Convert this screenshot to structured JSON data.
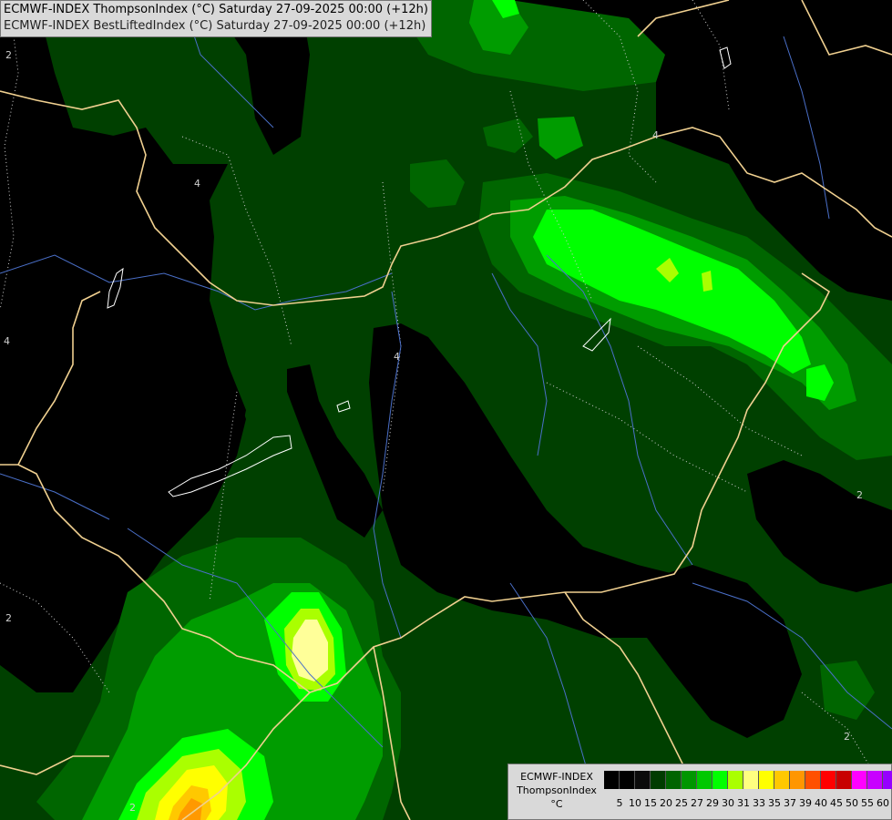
{
  "header": {
    "line1": "ECMWF-INDEX ThompsonIndex (°C) Saturday 27-09-2025 00:00 (+12h)",
    "line2": "ECMWF-INDEX BestLiftedIndex (°C) Saturday 27-09-2025 00:00 (+12h)"
  },
  "legend": {
    "title_line1": "ECMWF-INDEX",
    "title_line2": "ThompsonIndex",
    "title_line3": "°C",
    "colors": [
      "#000000",
      "#000000",
      "#0b0b0b",
      "#003c00",
      "#006400",
      "#009600",
      "#00c800",
      "#00ff00",
      "#aaff00",
      "#ffff80",
      "#ffff00",
      "#ffc800",
      "#ff9600",
      "#ff5000",
      "#ff0000",
      "#c80000",
      "#ff00ff",
      "#c800ff",
      "#9600ff",
      "#6400ff",
      "#0000ff"
    ],
    "ticks": [
      "5",
      "10",
      "15",
      "20",
      "25",
      "27",
      "29",
      "30",
      "31",
      "33",
      "35",
      "37",
      "39",
      "40",
      "45",
      "50",
      "55",
      "60"
    ]
  },
  "map": {
    "field_colors": {
      "dark": "#004000",
      "mid": "#006600",
      "green": "#00a000",
      "bright": "#00ff00",
      "yellowgreen": "#aaff00",
      "paleyellow": "#ffff99",
      "yellow": "#ffff00",
      "orange": "#ff9900",
      "border": "#f0d090",
      "river": "#4a6fc8",
      "lake": "#ffffff",
      "isoline": "#cfcfcf"
    },
    "contour_labels": [
      "2",
      "4",
      "4",
      "4",
      "4",
      "2",
      "2",
      "2",
      "2"
    ]
  }
}
